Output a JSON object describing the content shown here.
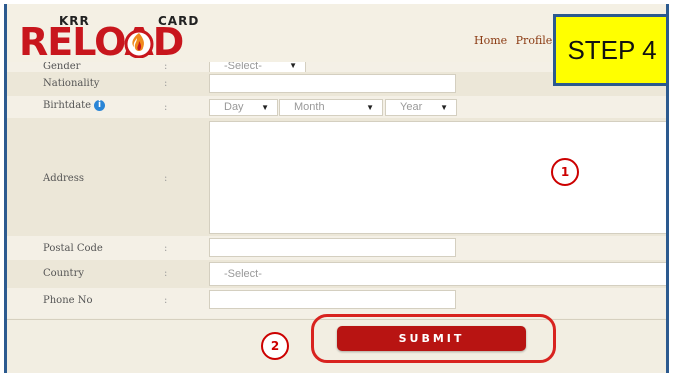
{
  "brand": {
    "top_left": "KRR",
    "top_right": "CARD",
    "word": "RELOAD",
    "color": "#c8161d"
  },
  "nav": {
    "items": [
      "Home",
      "Profile"
    ]
  },
  "callout": {
    "label": "STEP 4",
    "color": "#ffff00"
  },
  "form": {
    "gender": {
      "label": "Gender",
      "value": "-Select-"
    },
    "nationality": {
      "label": "Nationality",
      "value": ""
    },
    "birthdate": {
      "label": "Birhtdate",
      "info_icon": "info-icon",
      "day": "Day",
      "month": "Month",
      "year": "Year"
    },
    "address": {
      "label": "Address",
      "value": ""
    },
    "postal_code": {
      "label": "Postal Code",
      "value": ""
    },
    "country": {
      "label": "Country",
      "value": "-Select-"
    },
    "phone": {
      "label": "Phone No",
      "value": ""
    },
    "separator": ":"
  },
  "annotations": {
    "one": "1",
    "two": "2",
    "ring_color": "#d8231f"
  },
  "submit": {
    "label": "SUBMIT",
    "color": "#b81412"
  }
}
